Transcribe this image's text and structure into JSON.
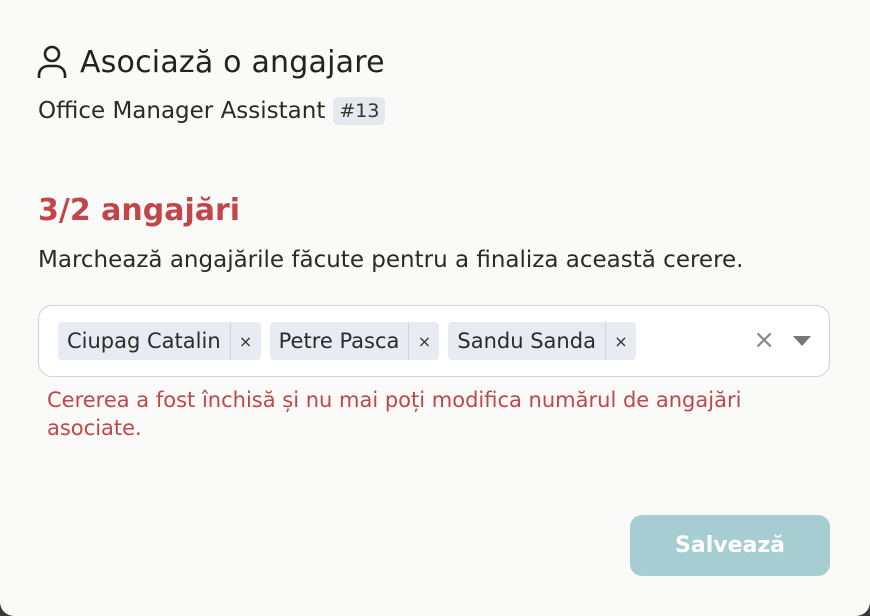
{
  "header": {
    "title": "Asociază o angajare",
    "icon": "user-icon"
  },
  "job": {
    "name": "Office Manager Assistant",
    "id_badge": "#13"
  },
  "hires": {
    "count_label": "3/2 angajări",
    "instruction": "Marchează angajările făcute pentru a finaliza această cerere."
  },
  "select": {
    "chips": [
      {
        "label": "Ciupag Catalin",
        "remove": "×"
      },
      {
        "label": "Petre Pasca",
        "remove": "×"
      },
      {
        "label": "Sandu Sanda",
        "remove": "×"
      }
    ],
    "clear_label": "×"
  },
  "error_message": "Cererea a fost închisă și nu mai poți modifica numărul de angajări asociate.",
  "actions": {
    "save_label": "Salvează"
  },
  "colors": {
    "error": "#c1464a",
    "save_button_bg": "#a6cdd1",
    "chip_bg": "#e8ebf2"
  }
}
